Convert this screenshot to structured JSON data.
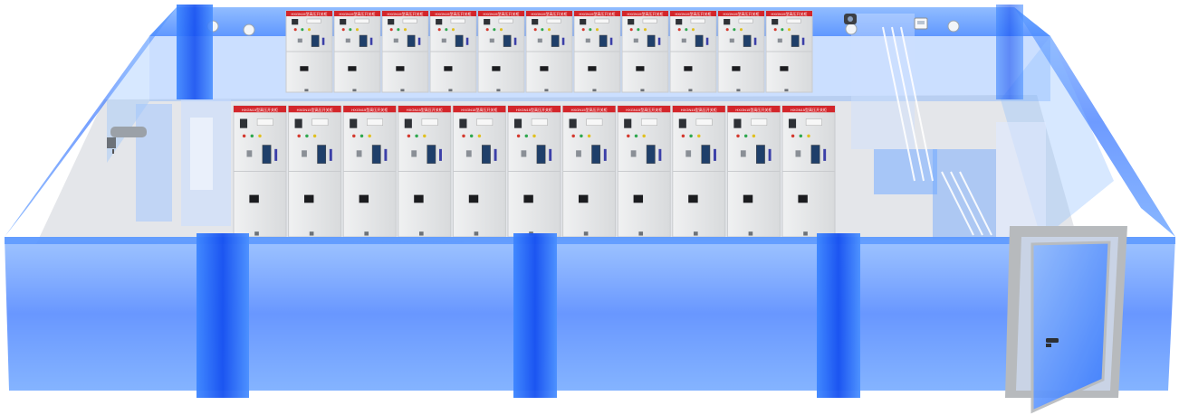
{
  "scene": {
    "subject": "switchgear-room",
    "colors": {
      "glass_wall": "#1f6fff",
      "glass_wall_light": "#7fb0ff",
      "floor": "#e4e6ea",
      "cabinet_body": "#e6e7e9",
      "cabinet_shadow": "#c9cbce",
      "cabinet_header": "#d3262b",
      "door_frame": "#b7babd",
      "door_panel": "#4a8cff"
    }
  },
  "back_row": {
    "count": 11,
    "header_label": "HXGN15型高压开关柜"
  },
  "front_row": {
    "count": 11,
    "header_label": "HXGN15型高压开关柜"
  },
  "fixtures": {
    "ceiling_lights": [
      "ceiling-light",
      "ceiling-light",
      "ceiling-light",
      "ceiling-light"
    ],
    "fire_extinguisher_icon": "fire-extinguisher-icon",
    "camera_icon": "camera-icon",
    "thermostat_icon": "thermostat-icon",
    "door_handle_icon": "door-handle-icon"
  }
}
